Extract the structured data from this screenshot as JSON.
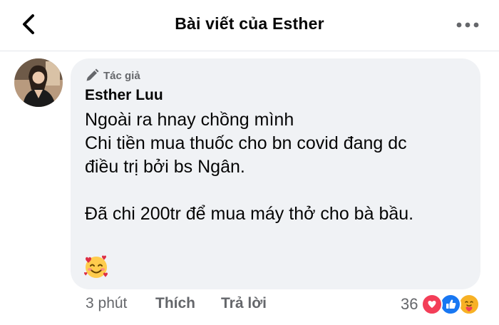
{
  "header": {
    "title": "Bài viết của Esther",
    "back_icon": "chevron-left-icon",
    "more_icon": "ellipsis-icon"
  },
  "comment": {
    "avatar_icon": "user-avatar",
    "badge_icon": "pencil-icon",
    "badge_label": "Tác giả",
    "author": "Esther Luu",
    "lines": [
      "Ngoài ra hnay chồng mình",
      "Chi tiền mua thuốc cho bn covid đang dc",
      "điều trị bởi bs Ngân.",
      "",
      "Đã chi 200tr để mua máy thở cho bà bầu."
    ],
    "emoji_icon": "smiling-face-with-hearts-emoji"
  },
  "actions": {
    "time": "3 phút",
    "like_label": "Thích",
    "reply_label": "Trả lời"
  },
  "reactions": {
    "count": "36",
    "icons": [
      "heart-reaction-icon",
      "like-reaction-icon",
      "care-reaction-icon"
    ]
  },
  "colors": {
    "bubble": "#f0f2f5",
    "secondary_text": "#65676b",
    "like_blue": "#1877f2",
    "heart_red": "#f33e58",
    "care_yellow": "#f7b125"
  }
}
